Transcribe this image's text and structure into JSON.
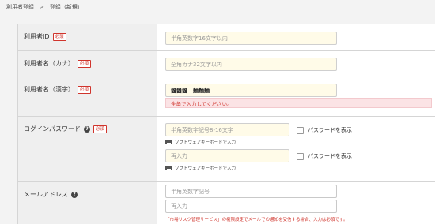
{
  "breadcrumb": {
    "parent": "利用者登録",
    "separator": ">",
    "current": "登録（新規）"
  },
  "required_badge": "必須",
  "help_glyph": "?",
  "fields": {
    "user_id": {
      "label": "利用者ID",
      "placeholder": "半角英数字16文字以内"
    },
    "name_kana": {
      "label": "利用者名（カナ）",
      "placeholder": "全角カナ32文字以内"
    },
    "name_kanji": {
      "label": "利用者名（漢字）",
      "value": "醤醤醤　麵麵麵",
      "error": "全角で入力してください。"
    },
    "password": {
      "label": "ログインパスワード",
      "placeholder": "半角英数字記号8-16文字",
      "hint": "ソフトウェアキーボードで入力",
      "show_label": "パスワードを表示",
      "confirm_placeholder": "再入力",
      "confirm_hint": "ソフトウェアキーボードで入力",
      "confirm_show_label": "パスワードを表示"
    },
    "email": {
      "label": "メールアドレス",
      "placeholder": "半角英数字記号",
      "confirm_placeholder": "再入力",
      "note": "「市場リスク管理サービス」の権限設定でメールでの通知を受信する場合、入力は必須です。"
    }
  },
  "colors": {
    "required": "#d0342c",
    "error_bg": "#fbe3e5",
    "input_highlight": "#fffbe8"
  }
}
